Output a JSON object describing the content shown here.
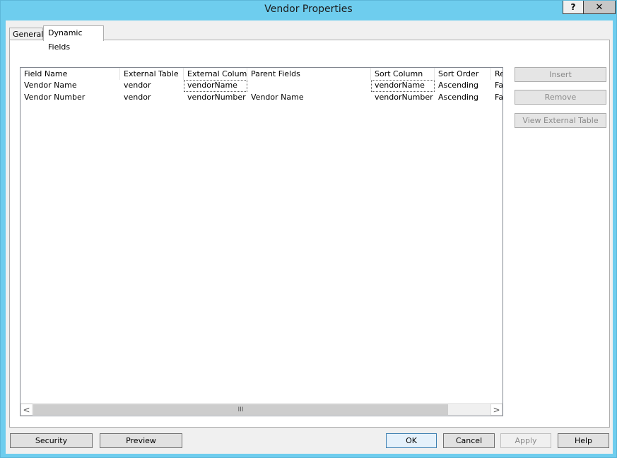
{
  "window": {
    "title": "Vendor Properties",
    "help_label": "?",
    "close_label": "✕"
  },
  "tabs": [
    {
      "label": "General",
      "selected": false
    },
    {
      "label": "Dynamic Fields",
      "selected": true
    }
  ],
  "grid": {
    "columns": [
      "Field Name",
      "External Table",
      "External Column",
      "Parent Fields",
      "Sort Column",
      "Sort Order",
      "Re"
    ],
    "rows": [
      [
        "Vendor Name",
        "vendor",
        "vendorName",
        "",
        "vendorName",
        "Ascending",
        "Fa"
      ],
      [
        "Vendor Number",
        "vendor",
        "vendorNumber",
        "Vendor Name",
        "vendorNumber",
        "Ascending",
        "Fa"
      ]
    ],
    "scroll_left": "<",
    "scroll_right": ">",
    "scroll_grip": "III"
  },
  "side_buttons": {
    "insert": "Insert",
    "remove": "Remove",
    "view_external_table": "View External Table"
  },
  "bottom_buttons": {
    "security": "Security",
    "preview": "Preview",
    "ok": "OK",
    "cancel": "Cancel",
    "apply": "Apply",
    "help": "Help"
  }
}
